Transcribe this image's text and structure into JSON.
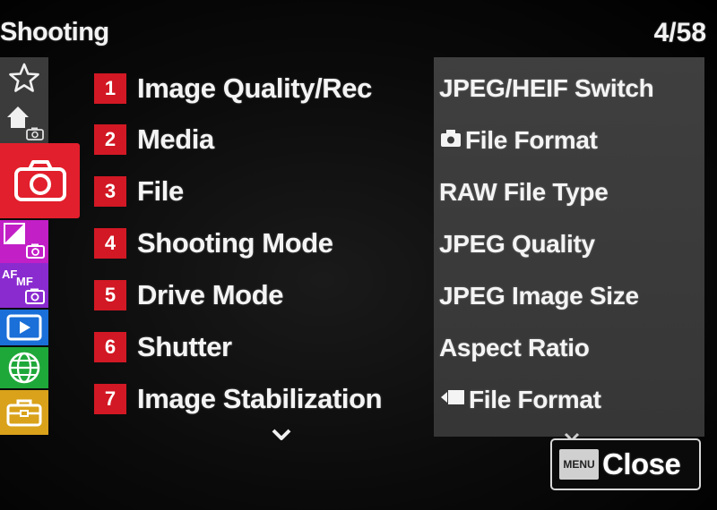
{
  "header": {
    "title": "Shooting",
    "page_counter": "4/58"
  },
  "tabs": [
    {
      "name": "favorites",
      "icon": "star-icon",
      "color": "#3b3b3b"
    },
    {
      "name": "main",
      "icon": "home-camera-icon",
      "color": "#3b3b3b"
    },
    {
      "name": "shooting",
      "icon": "camera-icon",
      "color": "#e21f2c",
      "selected": true
    },
    {
      "name": "exposure-color",
      "icon": "exposure-camera-icon",
      "color": "#c21fc7"
    },
    {
      "name": "focus",
      "icon": "af-mf-icon",
      "color": "#8a2bd0"
    },
    {
      "name": "playback",
      "icon": "play-icon",
      "color": "#1a6fd8"
    },
    {
      "name": "network",
      "icon": "globe-icon",
      "color": "#1fa83a"
    },
    {
      "name": "setup",
      "icon": "toolbox-icon",
      "color": "#d9a21a"
    }
  ],
  "menu": {
    "items": [
      {
        "num": "1",
        "label": "Image Quality/Rec",
        "selected": true
      },
      {
        "num": "2",
        "label": "Media"
      },
      {
        "num": "3",
        "label": "File"
      },
      {
        "num": "4",
        "label": "Shooting Mode"
      },
      {
        "num": "5",
        "label": "Drive Mode"
      },
      {
        "num": "6",
        "label": "Shutter"
      },
      {
        "num": "7",
        "label": "Image Stabilization"
      }
    ]
  },
  "submenu": {
    "items": [
      {
        "label": "JPEG/HEIF Switch"
      },
      {
        "label": "File Format",
        "icon": "still-camera-icon"
      },
      {
        "label": "RAW File Type"
      },
      {
        "label": "JPEG Quality"
      },
      {
        "label": "JPEG Image Size"
      },
      {
        "label": "Aspect Ratio"
      },
      {
        "label": "File Format",
        "icon": "movie-icon"
      }
    ]
  },
  "footer": {
    "menu_badge": "MENU",
    "close_label": "Close"
  }
}
